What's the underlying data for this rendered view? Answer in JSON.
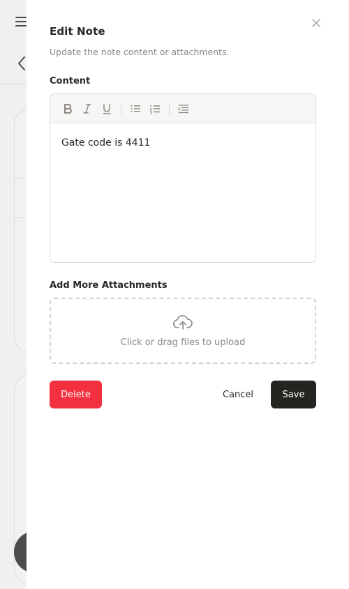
{
  "drawer": {
    "title": "Edit Note",
    "subtitle": "Update the note content or attachments.",
    "close_icon": "close-icon"
  },
  "content": {
    "label": "Content",
    "value": "Gate code is 4411",
    "toolbar": [
      "bold-icon",
      "italic-icon",
      "underline-icon",
      "bullet-list-icon",
      "numbered-list-icon",
      "indent-icon"
    ]
  },
  "attachments": {
    "label": "Add More Attachments",
    "dropzone_text": "Click or drag files to upload",
    "upload_icon": "cloud-upload-icon"
  },
  "actions": {
    "delete_label": "Delete",
    "cancel_label": "Cancel",
    "save_label": "Save"
  },
  "colors": {
    "delete": "#f3303f",
    "save": "#262421",
    "muted_text": "#8c8884"
  }
}
